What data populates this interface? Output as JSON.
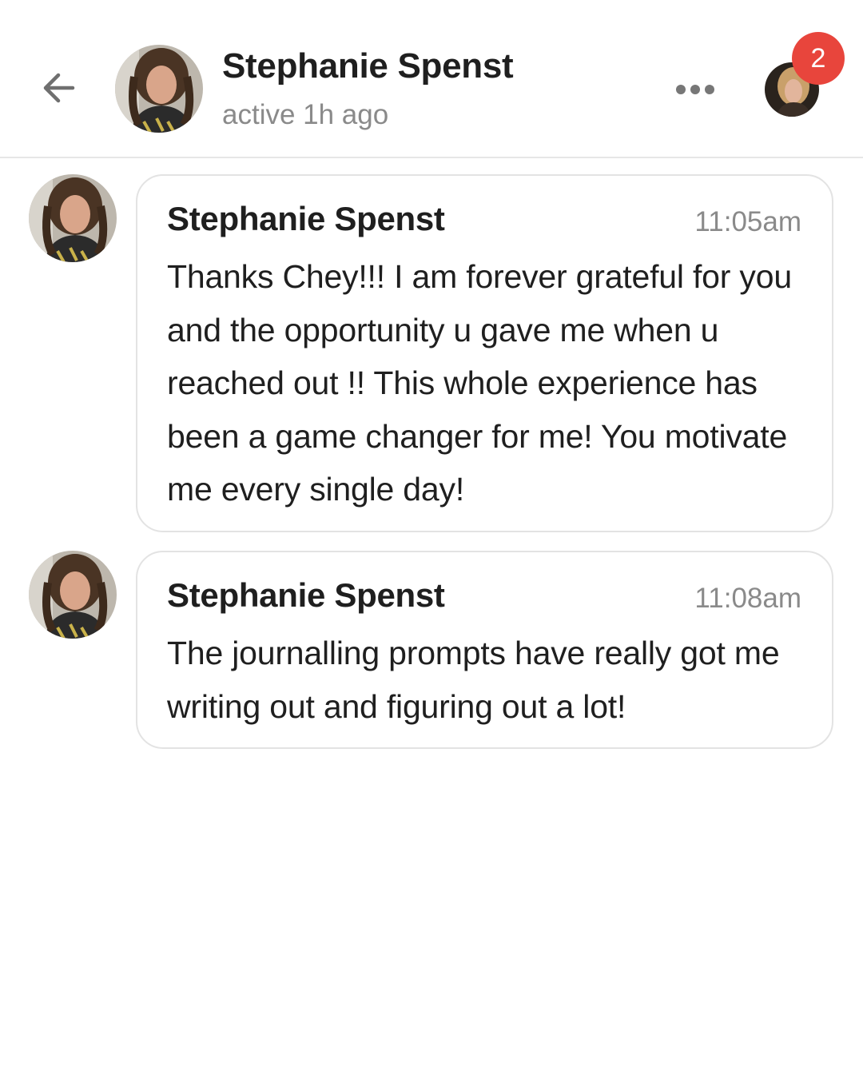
{
  "header": {
    "contact_name": "Stephanie Spenst",
    "status": "active 1h ago",
    "notification_count": "2"
  },
  "icons": {
    "back": "arrow-left-icon",
    "more": "more-horizontal-icon"
  },
  "colors": {
    "badge": "#e8453c",
    "muted_text": "#8a8a8a",
    "bubble_border": "#e3e3e3"
  },
  "messages": [
    {
      "sender": "Stephanie Spenst",
      "time": "11:05am",
      "text": "Thanks Chey!!! I am forever grateful for you and the opportunity u gave me when u reached out !! This whole experience has been a game changer for me! You motivate me every single day!"
    },
    {
      "sender": "Stephanie Spenst",
      "time": "11:08am",
      "text": "The journalling prompts have really got me writing out and figuring out a lot!"
    }
  ]
}
